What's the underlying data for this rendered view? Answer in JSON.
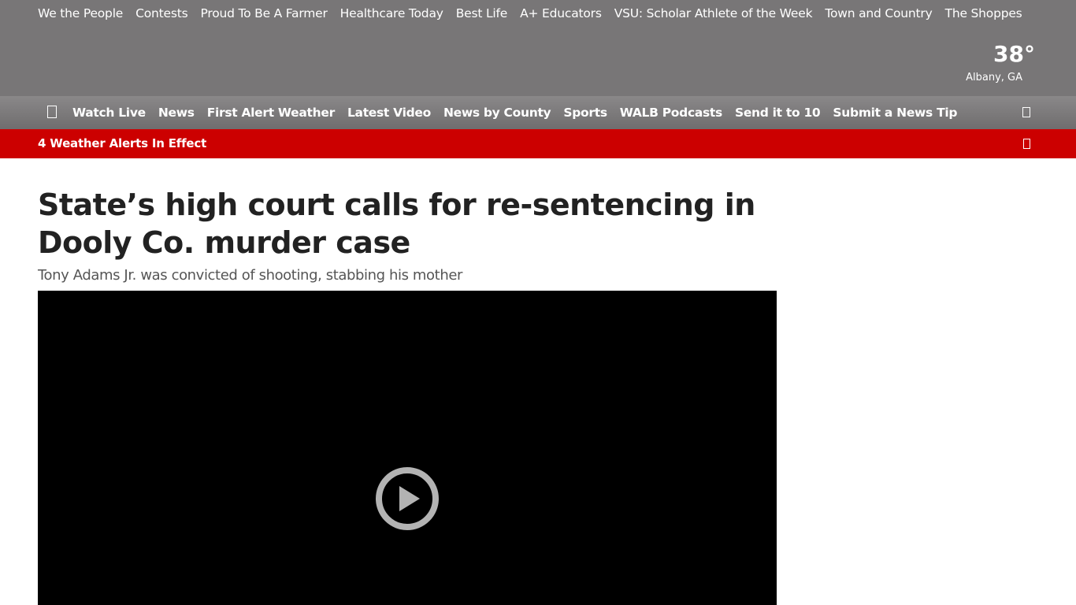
{
  "top_links": [
    "We the People",
    "Contests",
    "Proud To Be A Farmer",
    "Healthcare Today",
    "Best Life",
    "A+ Educators",
    "VSU: Scholar Athlete of the Week",
    "Town and Country",
    "The Shoppes"
  ],
  "weather": {
    "temperature": "38°",
    "location": "Albany, GA"
  },
  "nav": {
    "items": [
      "Watch Live",
      "News",
      "First Alert Weather",
      "Latest Video",
      "News by County",
      "Sports",
      "WALB Podcasts",
      "Send it to 10",
      "Submit a News Tip"
    ],
    "menu_icon": "hamburger-menu-icon",
    "search_icon": "search-icon"
  },
  "alert": {
    "text": "4 Weather Alerts In Effect",
    "toggle_icon": "chevron-down-icon",
    "color": "#cc0000"
  },
  "article": {
    "headline": "State’s high court calls for re-sentencing in Dooly Co. murder case",
    "subhead": "Tony Adams Jr. was convicted of shooting, stabbing his mother",
    "video": {
      "play_icon": "play-circle-icon"
    }
  },
  "colors": {
    "header_bg": "#787677",
    "alert_bg": "#cc0000",
    "headline_text": "#222222"
  }
}
